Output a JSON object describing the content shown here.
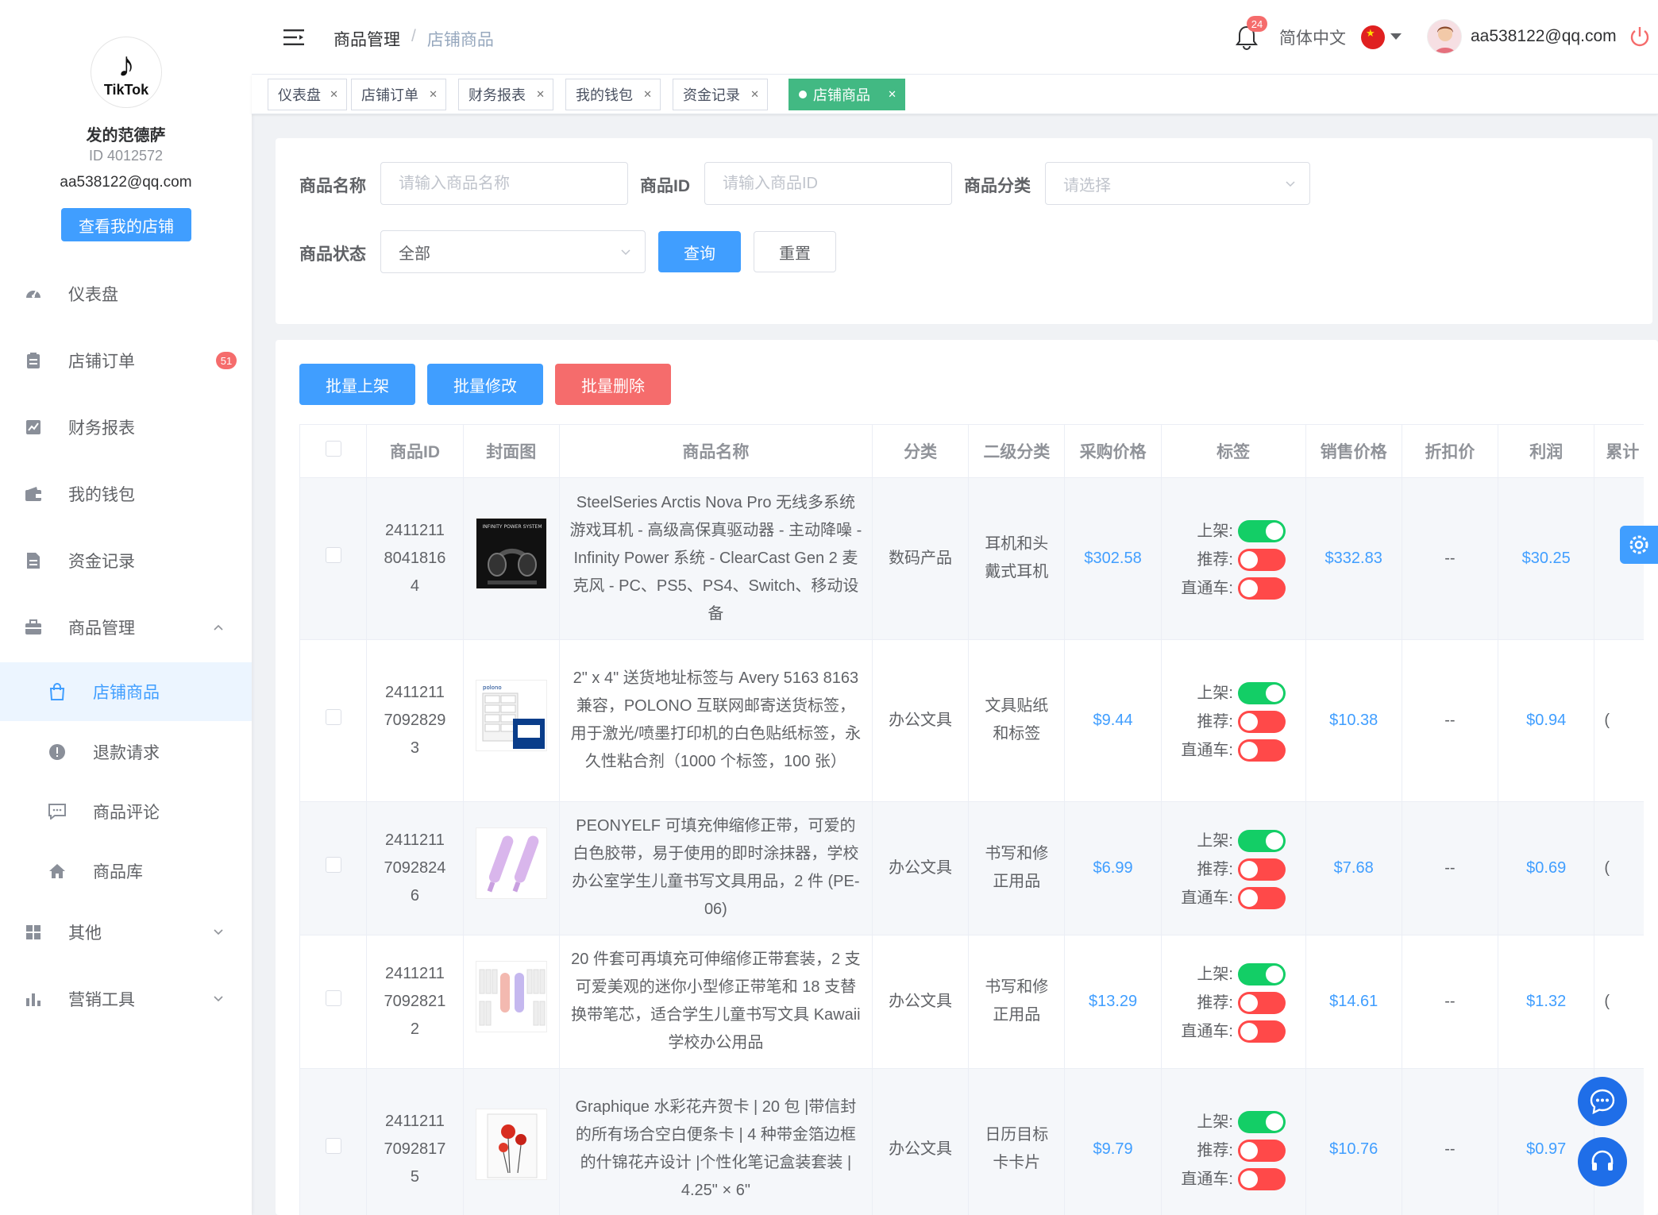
{
  "sidebar": {
    "logo_text": "TikTok",
    "shop_name": "发的范德萨",
    "shop_id": "ID 4012572",
    "shop_email": "aa538122@qq.com",
    "view_shop_label": "查看我的店铺",
    "items": [
      {
        "label": "仪表盘",
        "icon": "dashboard-icon"
      },
      {
        "label": "店铺订单",
        "icon": "clipboard-icon",
        "badge": "51"
      },
      {
        "label": "财务报表",
        "icon": "chart-icon"
      },
      {
        "label": "我的钱包",
        "icon": "wallet-icon"
      },
      {
        "label": "资金记录",
        "icon": "document-icon"
      },
      {
        "label": "商品管理",
        "icon": "briefcase-icon",
        "expanded": true
      },
      {
        "label": "店铺商品",
        "icon": "shopping-bag-icon",
        "active": true
      },
      {
        "label": "退款请求",
        "icon": "alert-icon"
      },
      {
        "label": "商品评论",
        "icon": "comment-icon"
      },
      {
        "label": "商品库",
        "icon": "home-icon"
      },
      {
        "label": "其他",
        "icon": "grid-icon"
      },
      {
        "label": "营销工具",
        "icon": "bar-chart-icon"
      }
    ]
  },
  "header": {
    "breadcrumb_parent": "商品管理",
    "breadcrumb_sep": "/",
    "breadcrumb_current": "店铺商品",
    "notification_count": "24",
    "language": "简体中文",
    "user_email": "aa538122@qq.com"
  },
  "tabs": [
    {
      "label": "仪表盘"
    },
    {
      "label": "店铺订单"
    },
    {
      "label": "财务报表"
    },
    {
      "label": "我的钱包"
    },
    {
      "label": "资金记录"
    },
    {
      "label": "店铺商品",
      "active": true
    }
  ],
  "filters": {
    "name_label": "商品名称",
    "name_placeholder": "请输入商品名称",
    "id_label": "商品ID",
    "id_placeholder": "请输入商品ID",
    "category_label": "商品分类",
    "category_placeholder": "请选择",
    "status_label": "商品状态",
    "status_value": "全部",
    "query_label": "查询",
    "reset_label": "重置"
  },
  "actions": {
    "batch_list": "批量上架",
    "batch_edit": "批量修改",
    "batch_delete": "批量删除"
  },
  "table": {
    "columns": [
      "商品ID",
      "封面图",
      "商品名称",
      "分类",
      "二级分类",
      "采购价格",
      "标签",
      "销售价格",
      "折扣价",
      "利润",
      "累计"
    ],
    "label_names": {
      "listed": "上架:",
      "recommended": "推荐:",
      "express": "直通车:"
    },
    "rows": [
      {
        "id": "24112118041816 4",
        "id_lines": [
          "2411211",
          "8041816",
          "4"
        ],
        "name": "SteelSeries Arctis Nova Pro 无线多系统游戏耳机 - 高级高保真驱动器 - 主动降噪 - Infinity Power 系统 - ClearCast Gen 2 麦克风 - PC、PS5、PS4、Switch、移动设备",
        "category": "数码产品",
        "subcategory": "耳机和头戴式耳机",
        "purchase_price": "$302.58",
        "listed": true,
        "recommended": false,
        "express": false,
        "sale_price": "$332.83",
        "discount": "--",
        "profit": "$30.25",
        "cumulative": "",
        "thumb": "headphones"
      },
      {
        "id_lines": [
          "2411211",
          "7092829",
          "3"
        ],
        "name": "2\" x 4\" 送货地址标签与 Avery 5163 8163 兼容，POLONO 互联网邮寄送货标签，用于激光/喷墨打印机的白色贴纸标签，永久性粘合剂（1000 个标签，100 张）",
        "category": "办公文具",
        "subcategory": "文具贴纸和标签",
        "purchase_price": "$9.44",
        "listed": true,
        "recommended": false,
        "express": false,
        "sale_price": "$10.38",
        "discount": "--",
        "profit": "$0.94",
        "cumulative": "(",
        "thumb": "labels"
      },
      {
        "id_lines": [
          "2411211",
          "7092824",
          "6"
        ],
        "name": "PEONYELF 可填充伸缩修正带，可爱的白色胶带，易于使用的即时涂抹器，学校办公室学生儿童书写文具用品，2 件 (PE-06)",
        "category": "办公文具",
        "subcategory": "书写和修正用品",
        "purchase_price": "$6.99",
        "listed": true,
        "recommended": false,
        "express": false,
        "sale_price": "$7.68",
        "discount": "--",
        "profit": "$0.69",
        "cumulative": "(",
        "thumb": "pens"
      },
      {
        "id_lines": [
          "2411211",
          "7092821",
          "2"
        ],
        "name": "20 件套可再填充可伸缩修正带套装，2 支可爱美观的迷你小型修正带笔和 18 支替换带笔芯，适合学生儿童书写文具 Kawaii 学校办公用品",
        "category": "办公文具",
        "subcategory": "书写和修正用品",
        "purchase_price": "$13.29",
        "listed": true,
        "recommended": false,
        "express": false,
        "sale_price": "$14.61",
        "discount": "--",
        "profit": "$1.32",
        "cumulative": "(",
        "thumb": "tapes"
      },
      {
        "id_lines": [
          "2411211",
          "7092817",
          "5"
        ],
        "name": "Graphique 水彩花卉贺卡 | 20 包 |带信封的所有场合空白便条卡 | 4 种带金箔边框的什锦花卉设计 |个性化笔记盒装套装 | 4.25\" × 6\"",
        "category": "办公文具",
        "subcategory": "日历目标卡卡片",
        "purchase_price": "$9.79",
        "listed": true,
        "recommended": false,
        "express": false,
        "sale_price": "$10.76",
        "discount": "--",
        "profit": "$0.97",
        "cumulative": "(",
        "thumb": "cards"
      }
    ]
  },
  "colors": {
    "primary": "#409eff",
    "danger": "#f56c6c",
    "success_tag": "#42b983",
    "switch_on": "#13ce66",
    "switch_off": "#ff4949"
  }
}
